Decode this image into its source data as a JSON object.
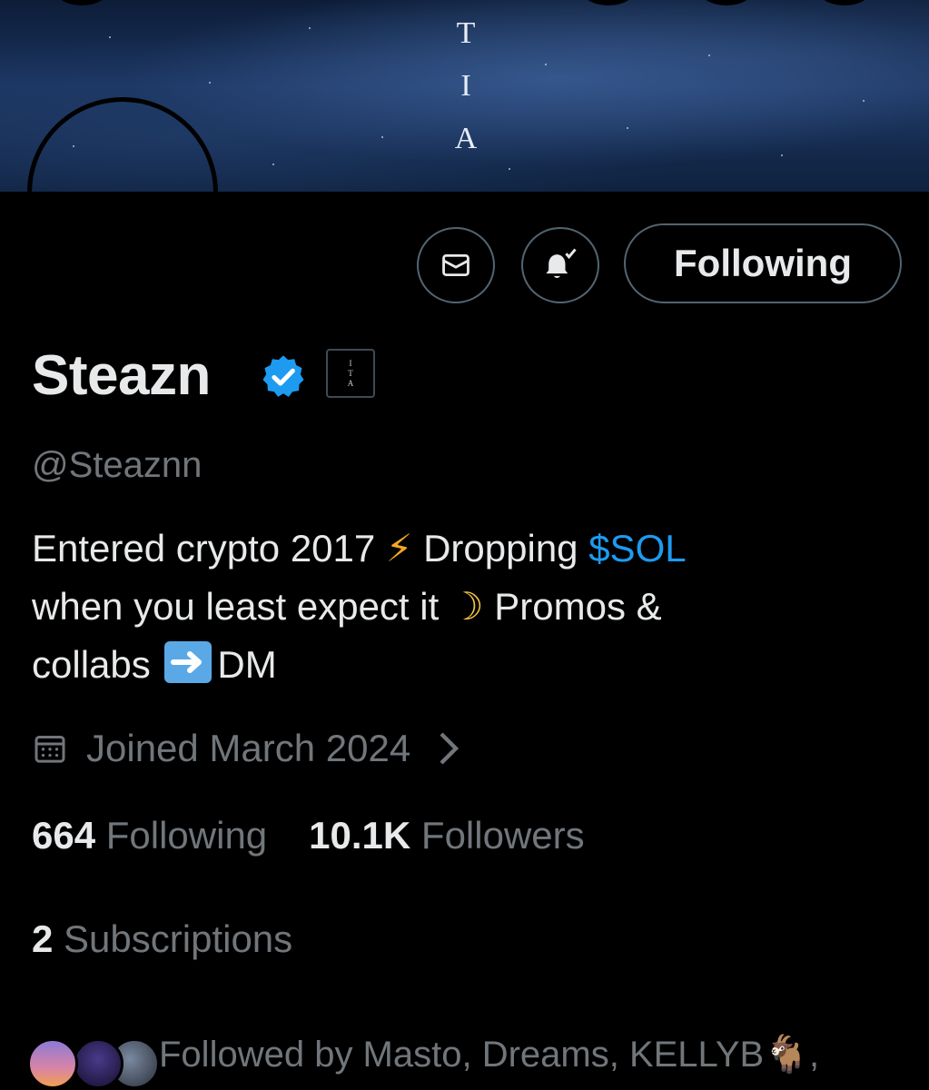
{
  "banner": {
    "letters": [
      "T",
      "I",
      "A"
    ]
  },
  "actions": {
    "message_icon": "envelope-icon",
    "notify_icon": "bell-check-icon",
    "follow_label": "Following"
  },
  "profile": {
    "name": "Steazn",
    "verified_icon": "verified-badge-icon",
    "affiliate_badge": [
      "I",
      "T",
      "A"
    ],
    "handle": "@Steaznn",
    "bio": {
      "line1_a": "Entered crypto 2017 ",
      "bolt": "⚡",
      "line1_b": "  Dropping ",
      "cashtag": "$SOL",
      "line2_a": "when you least expect it ",
      "moon": "☽",
      "line2_b": "  Promos &",
      "line3_a": "collabs ",
      "arrow": "➡",
      "line3_b": "DM"
    },
    "joined": "Joined March 2024",
    "following_count": "664",
    "following_label": "Following",
    "followers_count": "10.1K",
    "followers_label": "Followers",
    "subscriptions_count": "2",
    "subscriptions_label": "Subscriptions",
    "followed_by": "Followed by Masto, Dreams, KELLYB🐐,"
  },
  "colors": {
    "background": "#000000",
    "text": "#e7e9ea",
    "secondary": "#71767b",
    "accent": "#1d9bf0",
    "border": "#536471"
  }
}
